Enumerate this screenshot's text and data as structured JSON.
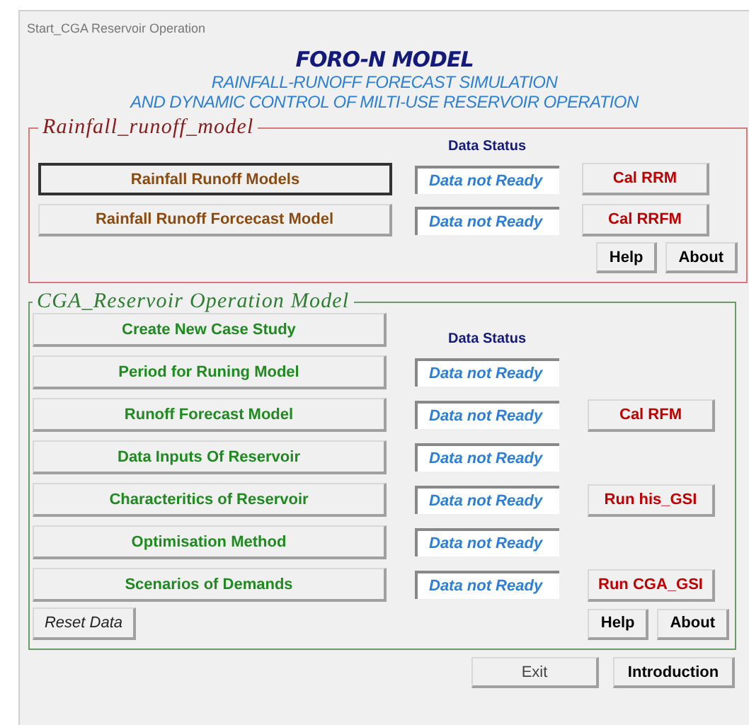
{
  "window": {
    "title": "Start_CGA Reservoir Operation"
  },
  "heading": {
    "title": "FORO-N MODEL",
    "subtitle_lines": [
      "RAINFALL-RUNOFF FORECAST SIMULATION",
      "AND DYNAMIC CONTROL OF MILTI-USE RESERVOIR OPERATION"
    ]
  },
  "groups": [
    {
      "kind": "rainfall",
      "legend": "Rainfall_runoff_model",
      "rows": [
        {
          "kind": "heading",
          "heading": "Data Status"
        },
        {
          "label": "Rainfall Runoff  Models",
          "focused": true,
          "status": "Data not Ready",
          "action": "Cal RRM"
        },
        {
          "label": "Rainfall Runoff Forcecast Model",
          "focused": false,
          "status": "Data not Ready",
          "action": "Cal RRFM"
        }
      ],
      "footer": {
        "right": [
          "Help",
          "About"
        ]
      }
    },
    {
      "kind": "reservoir",
      "legend": "CGA_Reservoir Operation Model",
      "rows": [
        {
          "label": "Create New Case Study",
          "focused": false,
          "heading": "Data Status"
        },
        {
          "label": "Period for Runing Model",
          "focused": false,
          "status": "Data not Ready"
        },
        {
          "label": "Runoff Forecast Model",
          "focused": false,
          "status": "Data not Ready",
          "action": "Cal RFM"
        },
        {
          "label": "Data Inputs Of Reservoir",
          "focused": false,
          "status": "Data not Ready"
        },
        {
          "label": "Characteritics of Reservoir",
          "focused": false,
          "status": "Data not Ready",
          "action": "Run his_GSI"
        },
        {
          "label": "Optimisation Method",
          "focused": false,
          "status": "Data not Ready"
        },
        {
          "label": "Scenarios of Demands",
          "focused": false,
          "status": "Data not Ready",
          "action": "Run CGA_GSI"
        }
      ],
      "footer": {
        "left": "Reset Data",
        "right": [
          "Help",
          "About"
        ]
      }
    }
  ],
  "bottom_buttons": [
    {
      "label": "Exit",
      "kind": "plain"
    },
    {
      "label": "Introduction",
      "kind": "bold"
    }
  ]
}
